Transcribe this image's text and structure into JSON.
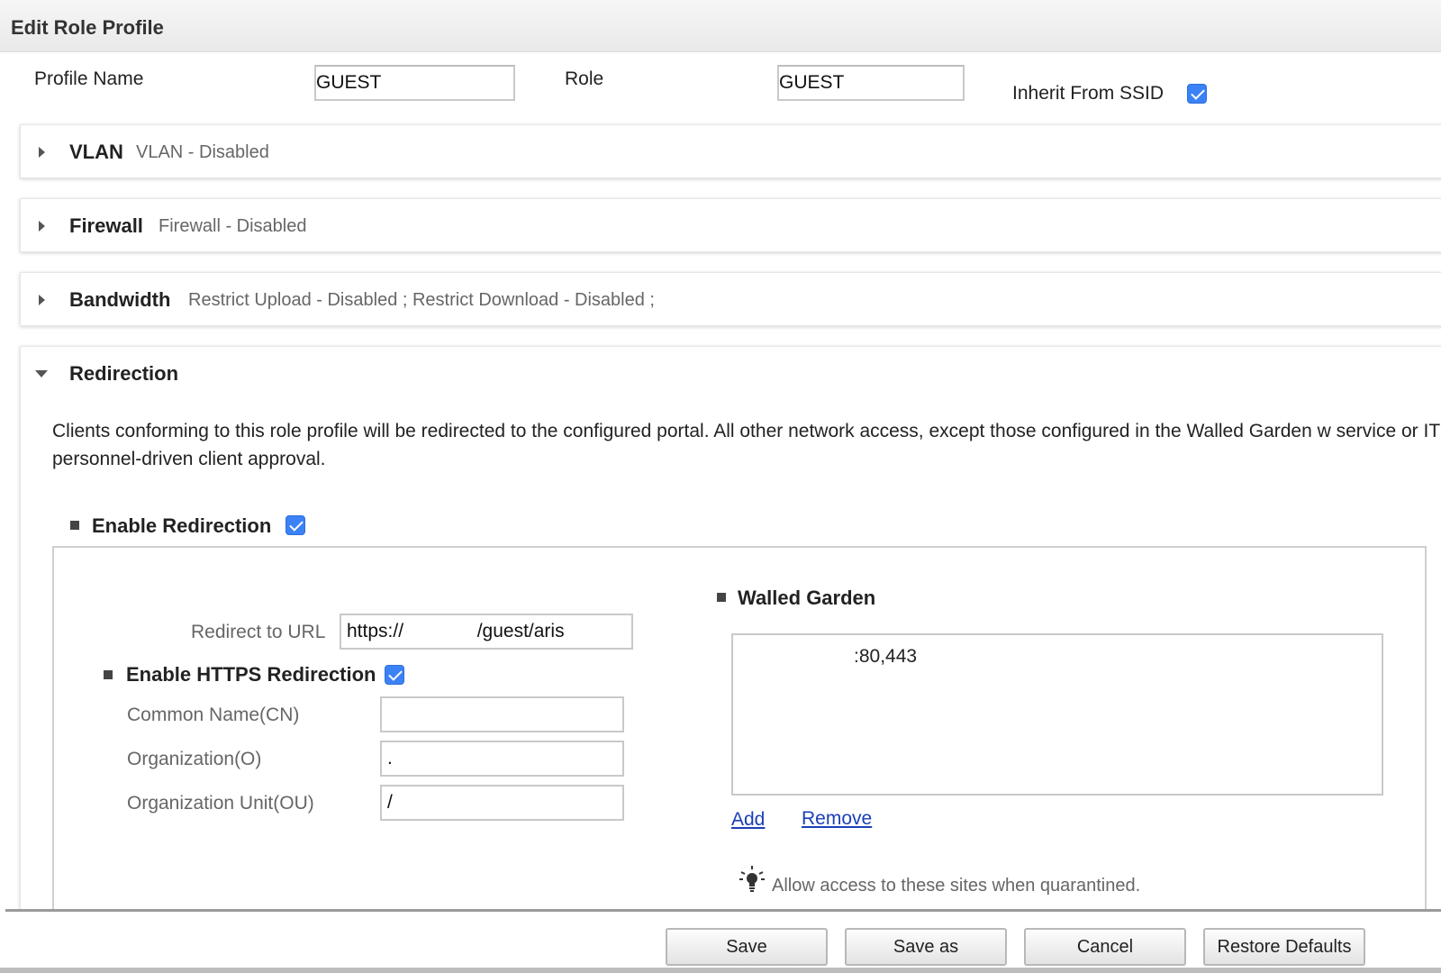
{
  "header": {
    "title": "Edit Role Profile"
  },
  "profile": {
    "name_label": "Profile Name",
    "name_value": "GUEST",
    "role_label": "Role",
    "role_value": "GUEST",
    "inherit_label": "Inherit From SSID",
    "inherit_checked": true
  },
  "sections": {
    "vlan": {
      "title": "VLAN",
      "summary": "VLAN - Disabled"
    },
    "firewall": {
      "title": "Firewall",
      "summary": "Firewall - Disabled"
    },
    "bandwidth": {
      "title": "Bandwidth",
      "summary": "Restrict Upload - Disabled ; Restrict Download - Disabled ;"
    },
    "redirection": {
      "title": "Redirection",
      "description": "Clients conforming to this role profile will be redirected to the configured portal. All other network access, except those configured in the Walled Garden w service or IT personnel-driven client approval.",
      "enable_label": "Enable Redirection",
      "enable_checked": true,
      "redirect_url_label": "Redirect to URL",
      "redirect_url_value": "https://              /guest/aris",
      "https_label": "Enable HTTPS Redirection",
      "https_checked": true,
      "cn_label": "Common Name(CN)",
      "cn_value": "",
      "o_label": "Organization(O)",
      "o_value": ".",
      "ou_label": "Organization Unit(OU)",
      "ou_value": "/",
      "walled_garden_label": "Walled Garden",
      "walled_garden_items": [
        ":80,443"
      ],
      "add_label": "Add",
      "remove_label": "Remove",
      "tip_text": "Allow access to these sites when quarantined."
    }
  },
  "footer": {
    "save_label": "Save",
    "save_as_label": "Save as",
    "cancel_label": "Cancel",
    "restore_label": "Restore Defaults"
  },
  "colors": {
    "checkbox": "#3b82f6",
    "link": "#1a3fb8"
  }
}
